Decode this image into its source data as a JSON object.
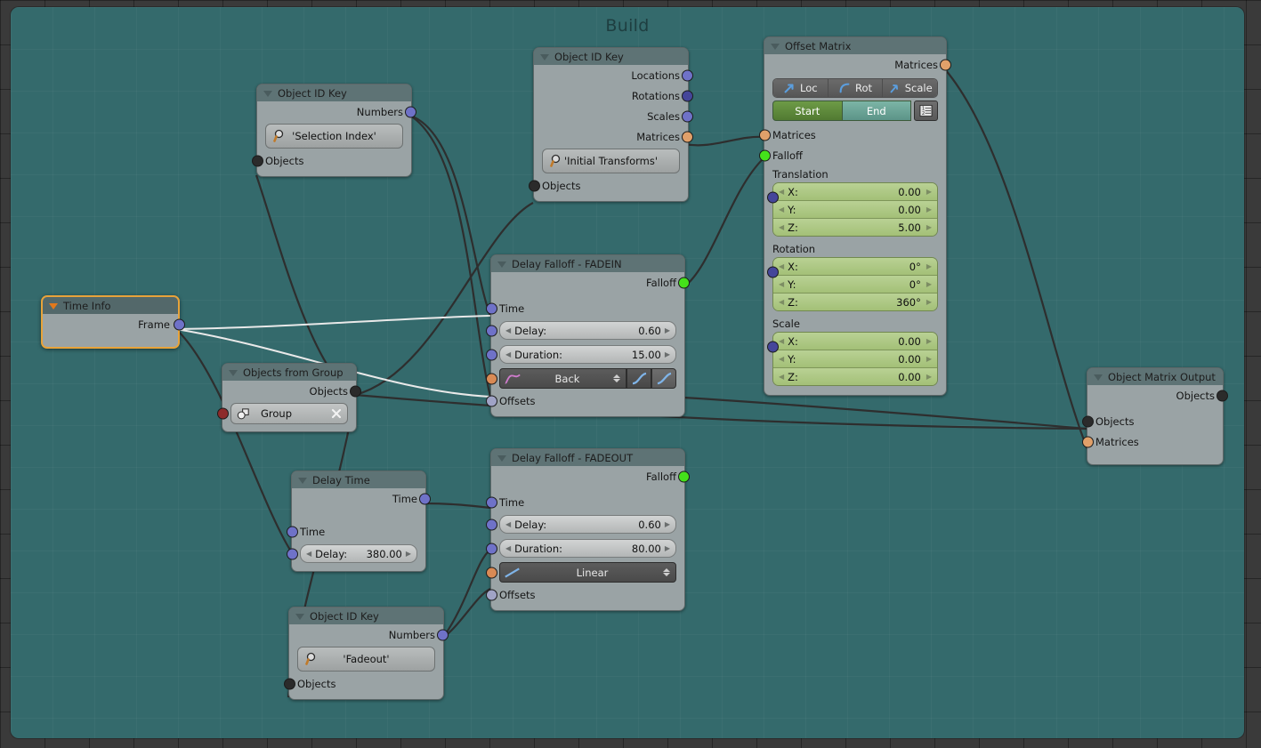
{
  "editor": {
    "frame_title": "Build",
    "background_color": "#346a6c",
    "outer_color": "#3a3a3a"
  },
  "nodes": {
    "object_id_key_selection": {
      "title": "Object ID Key",
      "outputs": [
        {
          "label": "Numbers",
          "socket": "number"
        }
      ],
      "field_value": "'Selection Index'",
      "inputs": [
        {
          "label": "Objects",
          "socket": "object"
        }
      ]
    },
    "object_id_key_initial": {
      "title": "Object ID Key",
      "outputs": [
        {
          "label": "Locations",
          "socket": "number"
        },
        {
          "label": "Rotations",
          "socket": "number2"
        },
        {
          "label": "Scales",
          "socket": "number"
        },
        {
          "label": "Matrices",
          "socket": "matrix"
        }
      ],
      "field_value": "'Initial Transforms'",
      "inputs": [
        {
          "label": "Objects",
          "socket": "object"
        }
      ]
    },
    "object_id_key_fadeout": {
      "title": "Object ID Key",
      "outputs": [
        {
          "label": "Numbers",
          "socket": "number"
        }
      ],
      "field_value": "'Fadeout'",
      "inputs": [
        {
          "label": "Objects",
          "socket": "object"
        }
      ]
    },
    "offset_matrix": {
      "title": "Offset Matrix",
      "outputs": [
        {
          "label": "Matrices",
          "socket": "matrix"
        }
      ],
      "toggles": [
        {
          "label": "Loc",
          "icon": "loc-arrow-icon"
        },
        {
          "label": "Rot",
          "icon": "rot-arc-icon"
        },
        {
          "label": "Scale",
          "icon": "scale-arrow-icon"
        }
      ],
      "range": {
        "start_label": "Start",
        "end_label": "End",
        "start_active": true
      },
      "list_icon": "list-icon",
      "inputs": [
        {
          "label": "Matrices",
          "socket": "matrix"
        },
        {
          "label": "Falloff",
          "socket": "falloff"
        }
      ],
      "translation": {
        "group_label": "Translation",
        "fields": [
          {
            "label": "X:",
            "value": "0.00"
          },
          {
            "label": "Y:",
            "value": "0.00"
          },
          {
            "label": "Z:",
            "value": "5.00"
          }
        ]
      },
      "rotation": {
        "group_label": "Rotation",
        "fields": [
          {
            "label": "X:",
            "value": "0°"
          },
          {
            "label": "Y:",
            "value": "0°"
          },
          {
            "label": "Z:",
            "value": "360°"
          }
        ]
      },
      "scale": {
        "group_label": "Scale",
        "fields": [
          {
            "label": "X:",
            "value": "0.00"
          },
          {
            "label": "Y:",
            "value": "0.00"
          },
          {
            "label": "Z:",
            "value": "0.00"
          }
        ]
      }
    },
    "delay_falloff_fadein": {
      "title": "Delay Falloff - FADEIN",
      "outputs": [
        {
          "label": "Falloff",
          "socket": "falloff"
        }
      ],
      "inputs": [
        {
          "label": "Time",
          "socket": "number"
        }
      ],
      "delay": {
        "label": "Delay:",
        "value": "0.60"
      },
      "duration": {
        "label": "Duration:",
        "value": "15.00"
      },
      "interpolation": {
        "value": "Back",
        "icon": "interpolation-curve-icon"
      },
      "ease_icons": [
        "ease-in-icon",
        "ease-out-icon"
      ],
      "offsets_label": "Offsets"
    },
    "delay_falloff_fadeout": {
      "title": "Delay Falloff - FADEOUT",
      "outputs": [
        {
          "label": "Falloff",
          "socket": "falloff"
        }
      ],
      "inputs": [
        {
          "label": "Time",
          "socket": "number"
        }
      ],
      "delay": {
        "label": "Delay:",
        "value": "0.60"
      },
      "duration": {
        "label": "Duration:",
        "value": "80.00"
      },
      "interpolation": {
        "value": "Linear",
        "icon": "linear-curve-icon"
      },
      "offsets_label": "Offsets"
    },
    "time_info": {
      "title": "Time Info",
      "selected": true,
      "outputs": [
        {
          "label": "Frame",
          "socket": "number"
        }
      ]
    },
    "objects_from_group": {
      "title": "Objects from Group",
      "outputs": [
        {
          "label": "Objects",
          "socket": "object"
        }
      ],
      "group_field": {
        "value": "Group",
        "icon": "group-icon",
        "clear_icon": "clear-x-icon"
      }
    },
    "delay_time": {
      "title": "Delay Time",
      "outputs": [
        {
          "label": "Time",
          "socket": "number"
        }
      ],
      "inputs": [
        {
          "label": "Time",
          "socket": "number"
        }
      ],
      "delay": {
        "label": "Delay:",
        "value": "380.00"
      }
    },
    "object_matrix_output": {
      "title": "Object Matrix Output",
      "outputs": [
        {
          "label": "Objects",
          "socket": "object"
        }
      ],
      "inputs": [
        {
          "label": "Objects",
          "socket": "object"
        },
        {
          "label": "Matrices",
          "socket": "matrix"
        }
      ]
    }
  },
  "socket_colors": {
    "object": "#2b2b2b",
    "matrix": "#e0a06a",
    "number": "#6f72c8",
    "number2": "#45469a",
    "falloff": "#44e11a",
    "offsets": "#a0a3c6",
    "group": "#8d2a2a",
    "interpolation": "#d98a55"
  }
}
